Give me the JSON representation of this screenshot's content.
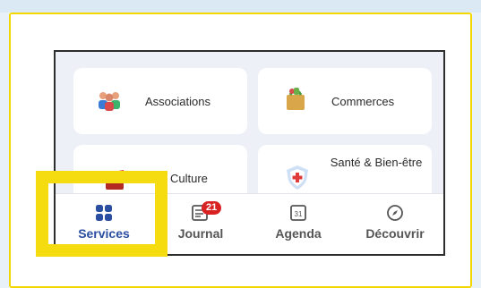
{
  "tiles": [
    {
      "label": "Associations",
      "icon": "people-icon"
    },
    {
      "label": "Commerces",
      "icon": "shopping-bag-icon"
    },
    {
      "label": "Culture",
      "icon": "culture-icon"
    },
    {
      "label": "Santé & Bien-être",
      "icon": "health-shield-icon"
    }
  ],
  "nav": {
    "services": {
      "label": "Services",
      "icon": "grid-icon"
    },
    "journal": {
      "label": "Journal",
      "icon": "newspaper-icon",
      "badge": "21"
    },
    "agenda": {
      "label": "Agenda",
      "icon": "calendar-icon",
      "day": "31"
    },
    "decouvrir": {
      "label": "Découvrir",
      "icon": "compass-icon"
    }
  },
  "colors": {
    "highlight": "#f5dc10",
    "active_nav": "#2a4ea0",
    "badge": "#d92323"
  }
}
